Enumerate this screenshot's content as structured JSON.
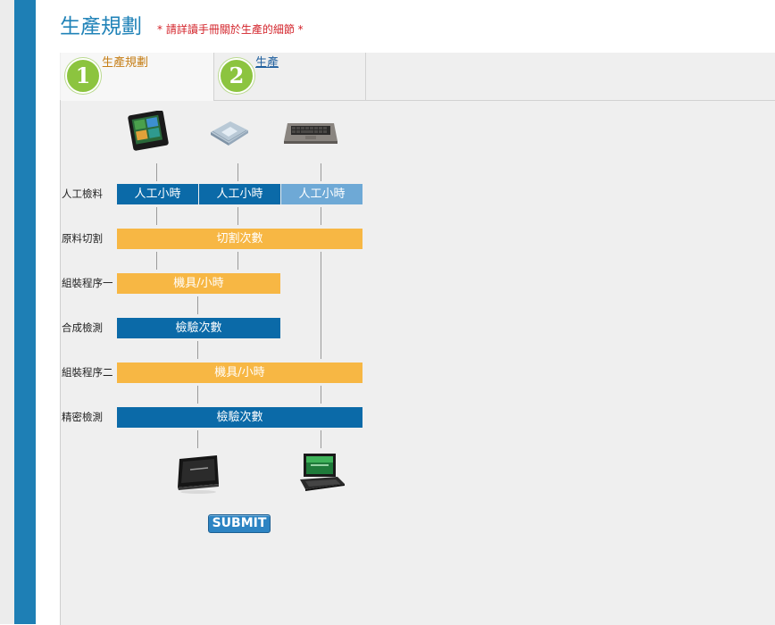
{
  "header": {
    "title": "生產規劃",
    "note": "* 請詳讀手冊關於生產的細節 *"
  },
  "tabs": [
    {
      "number": "1",
      "label": "生產規劃"
    },
    {
      "number": "2",
      "label": "生產"
    }
  ],
  "inputs": [
    {
      "name": "tablet-icon",
      "label": "tablet"
    },
    {
      "name": "cpu-chip-icon",
      "label": "processor chip"
    },
    {
      "name": "keyboard-icon",
      "label": "keyboard"
    }
  ],
  "rows": [
    {
      "label": "人工檢料",
      "bars": [
        "人工小時",
        "人工小時",
        "人工小時"
      ]
    },
    {
      "label": "原料切割",
      "bar": "切割次數"
    },
    {
      "label": "組裝程序一",
      "bar": "機具/小時"
    },
    {
      "label": "合成檢測",
      "bar": "檢驗次數"
    },
    {
      "label": "組裝程序二",
      "bar": "機具/小時"
    },
    {
      "label": "精密檢測",
      "bar": "檢驗次數"
    }
  ],
  "outputs": [
    {
      "name": "tablet-product-icon"
    },
    {
      "name": "netbook-product-icon"
    }
  ],
  "submit_label": "SUBMIT",
  "colors": {
    "sidebar": "#1e7fb5",
    "title": "#2183b8",
    "note": "#d3232a",
    "bar_blue": "#0b6aa8",
    "bar_light_blue": "#6ea9d6",
    "bar_orange": "#f7b744",
    "tab_number": "#8cc43f"
  }
}
